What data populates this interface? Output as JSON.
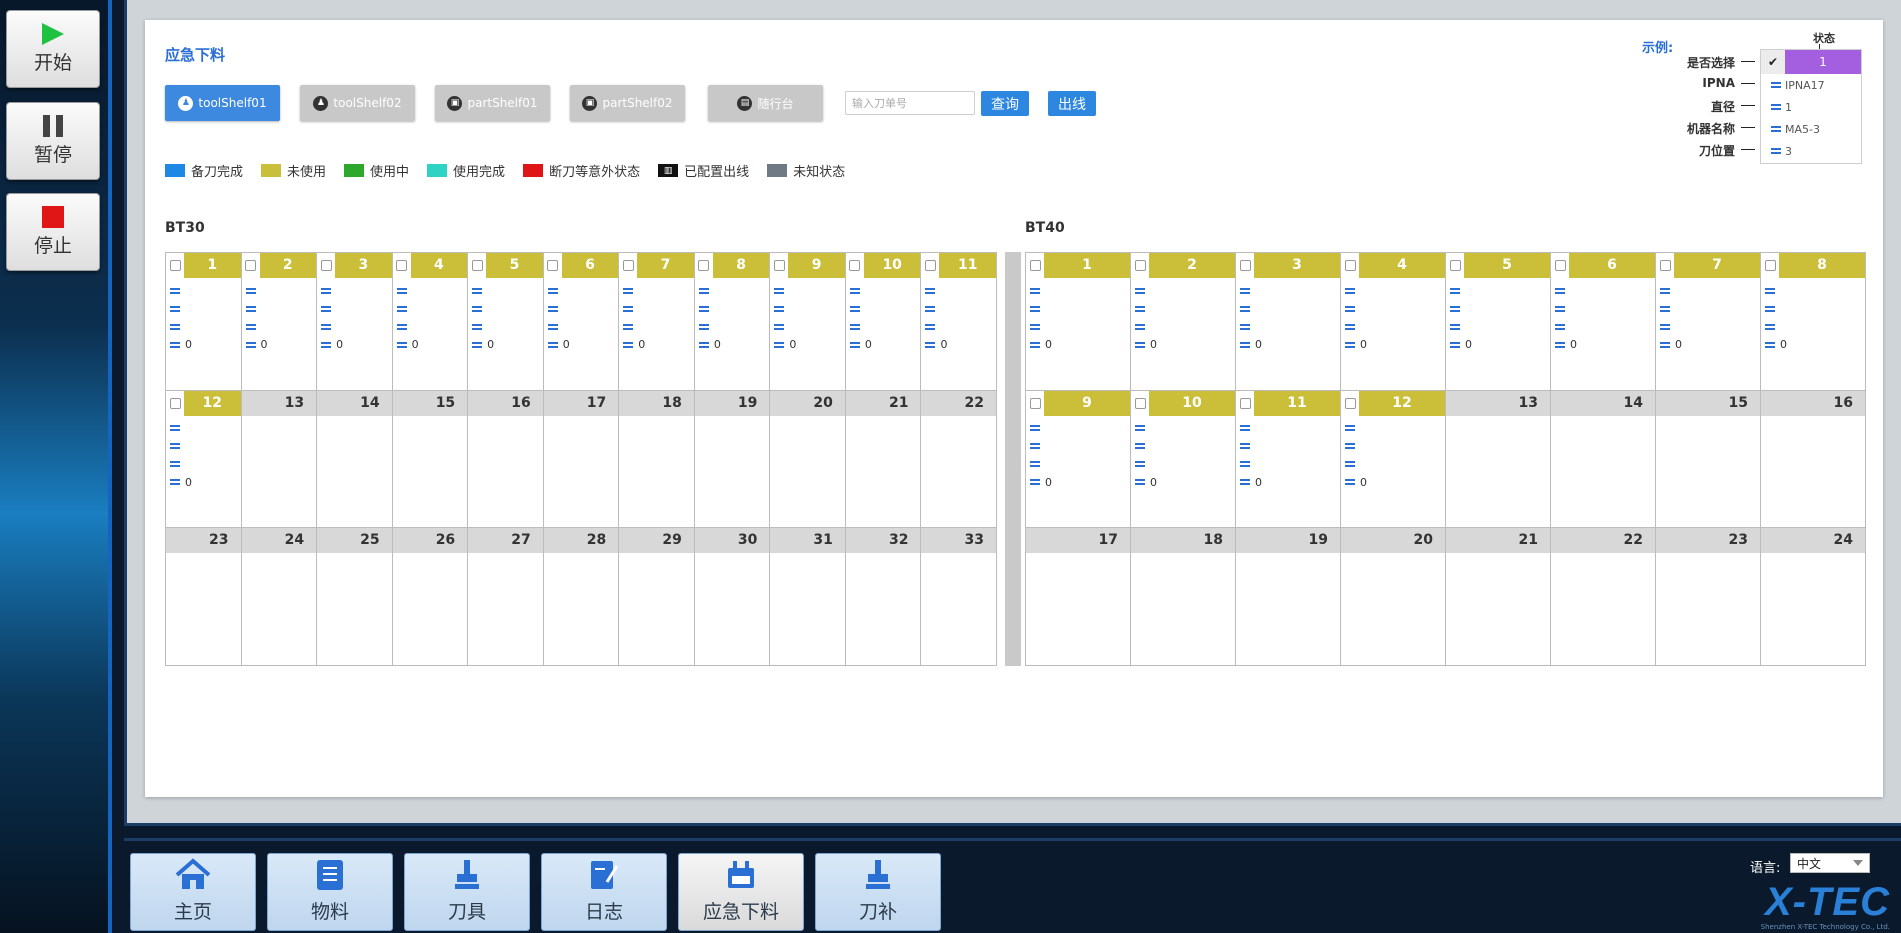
{
  "controls": {
    "start": "开始",
    "pause": "暂停",
    "stop": "停止"
  },
  "page": {
    "title": "应急下料"
  },
  "shelves": [
    {
      "label": "toolShelf01",
      "active": true
    },
    {
      "label": "toolShelf02",
      "active": false
    },
    {
      "label": "partShelf01",
      "active": false
    },
    {
      "label": "partShelf02",
      "active": false
    },
    {
      "label": "随行台",
      "active": false
    }
  ],
  "search": {
    "placeholder": "输入刀单号",
    "query_label": "查询",
    "out_label": "出线"
  },
  "legend": [
    {
      "label": "备刀完成",
      "color": "#1e88e5"
    },
    {
      "label": "未使用",
      "color": "#c9bf3b"
    },
    {
      "label": "使用中",
      "color": "#2da82d"
    },
    {
      "label": "使用完成",
      "color": "#2ed3c4"
    },
    {
      "label": "断刀等意外状态",
      "color": "#e01515"
    },
    {
      "label": "已配置出线",
      "color": "#111111"
    },
    {
      "label": "未知状态",
      "color": "#6f7a84"
    }
  ],
  "example": {
    "title": "示例:",
    "state_label": "状态",
    "number": "1",
    "fields": [
      {
        "label": "是否选择",
        "value": ""
      },
      {
        "label": "IPNA",
        "value": "IPNA17"
      },
      {
        "label": "直径",
        "value": "1"
      },
      {
        "label": "机器名称",
        "value": "MA5-3"
      },
      {
        "label": "刀位置",
        "value": "3"
      }
    ]
  },
  "bt30": {
    "title": "BT30",
    "slots": [
      {
        "n": "1",
        "used": true,
        "count": "0"
      },
      {
        "n": "2",
        "used": true,
        "count": "0"
      },
      {
        "n": "3",
        "used": true,
        "count": "0"
      },
      {
        "n": "4",
        "used": true,
        "count": "0"
      },
      {
        "n": "5",
        "used": true,
        "count": "0"
      },
      {
        "n": "6",
        "used": true,
        "count": "0"
      },
      {
        "n": "7",
        "used": true,
        "count": "0"
      },
      {
        "n": "8",
        "used": true,
        "count": "0"
      },
      {
        "n": "9",
        "used": true,
        "count": "0"
      },
      {
        "n": "10",
        "used": true,
        "count": "0"
      },
      {
        "n": "11",
        "used": true,
        "count": "0"
      },
      {
        "n": "12",
        "used": true,
        "count": "0"
      },
      {
        "n": "13",
        "used": false
      },
      {
        "n": "14",
        "used": false
      },
      {
        "n": "15",
        "used": false
      },
      {
        "n": "16",
        "used": false
      },
      {
        "n": "17",
        "used": false
      },
      {
        "n": "18",
        "used": false
      },
      {
        "n": "19",
        "used": false
      },
      {
        "n": "20",
        "used": false
      },
      {
        "n": "21",
        "used": false
      },
      {
        "n": "22",
        "used": false
      },
      {
        "n": "23",
        "used": false
      },
      {
        "n": "24",
        "used": false
      },
      {
        "n": "25",
        "used": false
      },
      {
        "n": "26",
        "used": false
      },
      {
        "n": "27",
        "used": false
      },
      {
        "n": "28",
        "used": false
      },
      {
        "n": "29",
        "used": false
      },
      {
        "n": "30",
        "used": false
      },
      {
        "n": "31",
        "used": false
      },
      {
        "n": "32",
        "used": false
      },
      {
        "n": "33",
        "used": false
      }
    ]
  },
  "bt40": {
    "title": "BT40",
    "slots": [
      {
        "n": "1",
        "used": true,
        "count": "0"
      },
      {
        "n": "2",
        "used": true,
        "count": "0"
      },
      {
        "n": "3",
        "used": true,
        "count": "0"
      },
      {
        "n": "4",
        "used": true,
        "count": "0"
      },
      {
        "n": "5",
        "used": true,
        "count": "0"
      },
      {
        "n": "6",
        "used": true,
        "count": "0"
      },
      {
        "n": "7",
        "used": true,
        "count": "0"
      },
      {
        "n": "8",
        "used": true,
        "count": "0"
      },
      {
        "n": "9",
        "used": true,
        "count": "0"
      },
      {
        "n": "10",
        "used": true,
        "count": "0"
      },
      {
        "n": "11",
        "used": true,
        "count": "0"
      },
      {
        "n": "12",
        "used": true,
        "count": "0"
      },
      {
        "n": "13",
        "used": false
      },
      {
        "n": "14",
        "used": false
      },
      {
        "n": "15",
        "used": false
      },
      {
        "n": "16",
        "used": false
      },
      {
        "n": "17",
        "used": false
      },
      {
        "n": "18",
        "used": false
      },
      {
        "n": "19",
        "used": false
      },
      {
        "n": "20",
        "used": false
      },
      {
        "n": "21",
        "used": false
      },
      {
        "n": "22",
        "used": false
      },
      {
        "n": "23",
        "used": false
      },
      {
        "n": "24",
        "used": false
      }
    ]
  },
  "nav": [
    {
      "label": "主页",
      "icon": "home-icon",
      "active": false
    },
    {
      "label": "物料",
      "icon": "material-list-icon",
      "active": false
    },
    {
      "label": "刀具",
      "icon": "tool-icon",
      "active": false
    },
    {
      "label": "日志",
      "icon": "log-icon",
      "active": false
    },
    {
      "label": "应急下料",
      "icon": "emergency-unload-icon",
      "active": true
    },
    {
      "label": "刀补",
      "icon": "tool-compensation-icon",
      "active": false
    }
  ],
  "language": {
    "label": "语言:",
    "value": "中文"
  },
  "brand": {
    "name": "X-TEC",
    "sub": "Shenzhen X-TEC Technology Co., Ltd."
  }
}
